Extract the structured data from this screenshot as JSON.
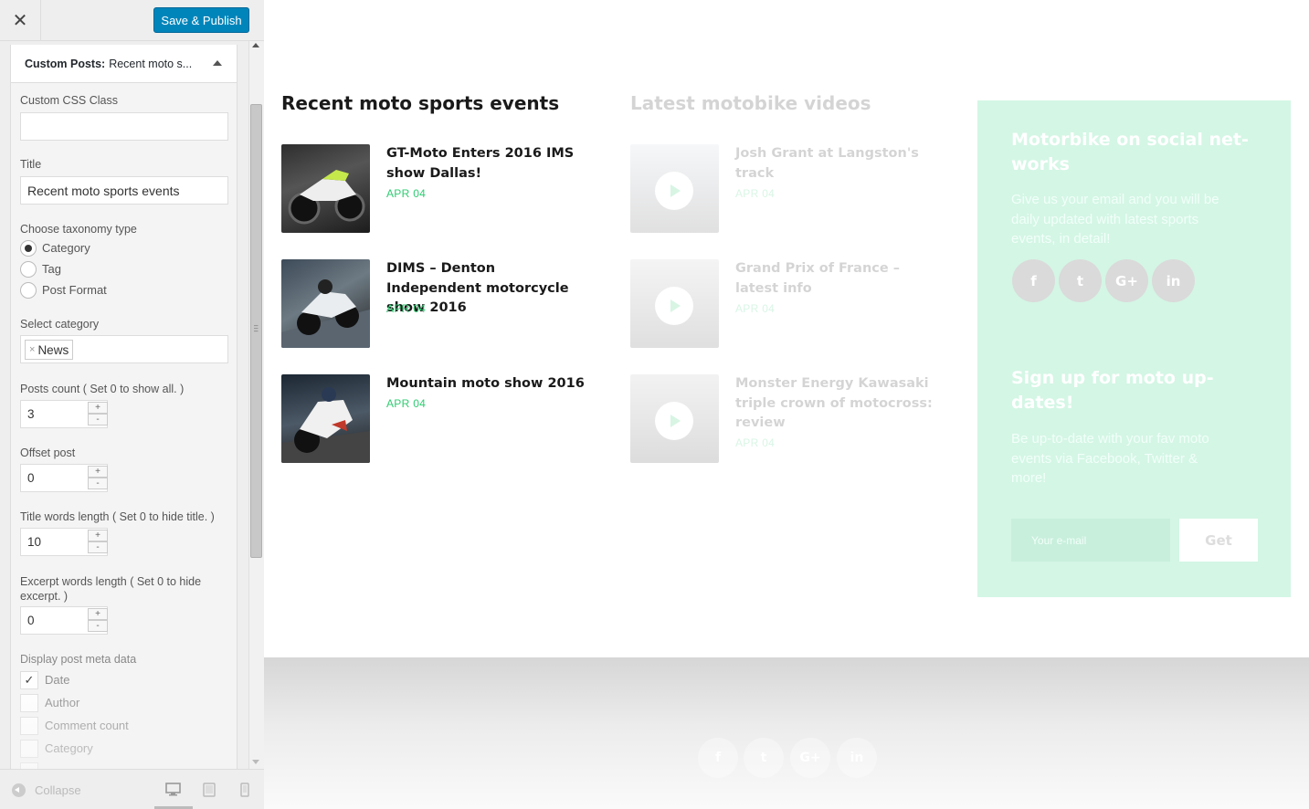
{
  "panel": {
    "close_icon": "close-icon",
    "publish_label": "Save & Publish",
    "section_prefix": "Custom Posts:",
    "section_name": "Recent moto s...",
    "fields": {
      "css_class_label": "Custom CSS Class",
      "css_class_value": "",
      "title_label": "Title",
      "title_value": "Recent moto sports events",
      "taxonomy_label": "Choose taxonomy type",
      "taxonomy_options": [
        "Category",
        "Tag",
        "Post Format"
      ],
      "taxonomy_selected": "Category",
      "select_category_label": "Select category",
      "selected_category_tag": "News",
      "posts_count_label": "Posts count ( Set 0 to show all. )",
      "posts_count_value": "3",
      "offset_label": "Offset post",
      "offset_value": "0",
      "title_words_label": "Title words length ( Set 0 to hide title. )",
      "title_words_value": "10",
      "excerpt_words_label_1": "Excerpt words length ( Set 0 to hide",
      "excerpt_words_label_2": "excerpt. )",
      "excerpt_words_value": "0",
      "meta_label": "Display post meta data",
      "meta_options": [
        {
          "label": "Date",
          "checked": true
        },
        {
          "label": "Author",
          "checked": false
        },
        {
          "label": "Comment count",
          "checked": false
        },
        {
          "label": "Category",
          "checked": false
        }
      ],
      "spin_up": "+",
      "spin_down": "-"
    },
    "footer": {
      "collapse_label": "Collapse"
    }
  },
  "preview": {
    "recent": {
      "title": "Recent moto sports events",
      "posts": [
        {
          "title": "GT-Moto Enters 2016 IMS show Dallas!",
          "date": "APR 04"
        },
        {
          "title": "DIMS – Denton Independent motorcycle show 2016",
          "date": "APR 04"
        },
        {
          "title": "Mountain moto show 2016",
          "date": "APR 04"
        }
      ]
    },
    "videos": {
      "title": "Latest motobike videos",
      "posts": [
        {
          "title": "Josh Grant at Langston's track",
          "date": "APR 04"
        },
        {
          "title": "Grand Prix of France – latest info",
          "date": "APR 04"
        },
        {
          "title": "Monster Energy Kawasaki triple crown of motocross: review",
          "date": "APR 04"
        }
      ]
    },
    "social": {
      "heading": "Motorbike on social net-works",
      "text": "Give us your email and you will be daily updated with latest sports events, in detail!",
      "icons": [
        "f",
        "t",
        "G+",
        "in"
      ],
      "signup_heading": "Sign up for moto up-dates!",
      "signup_text": "Be up-to-date with your fav moto events via Facebook, Twitter & more!",
      "email_placeholder": "Your e-mail",
      "get_label": "Get"
    },
    "footer_icons": [
      "f",
      "t",
      "G+",
      "in"
    ]
  },
  "colors": {
    "accent": "#2ecc71",
    "publish": "#0085ba",
    "social_box": "#d4f6e5"
  }
}
